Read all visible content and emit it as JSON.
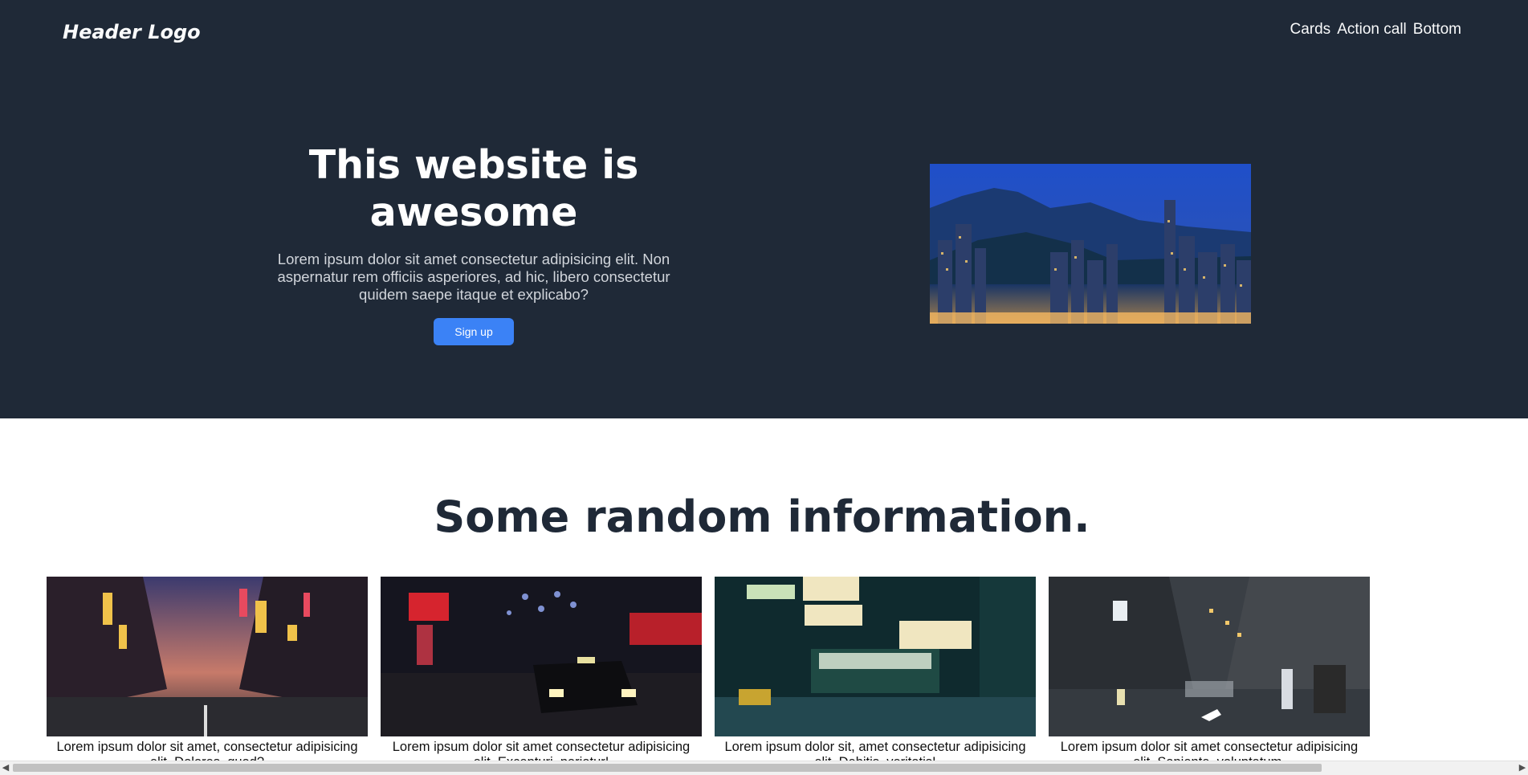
{
  "header": {
    "logo": "Header Logo",
    "nav": [
      "Cards",
      "Action call",
      "Bottom"
    ]
  },
  "hero": {
    "title": "This website is awesome",
    "subtitle": "Lorem ipsum dolor sit amet consectetur adipisicing elit. Non aspernatur rem officiis asperiores, ad hic, libero consectetur quidem saepe itaque et explicabo?",
    "button": "Sign up",
    "image_name": "city-skyline-night-photo"
  },
  "section": {
    "title": "Some random information."
  },
  "cards": [
    {
      "text": "Lorem ipsum dolor sit amet, consectetur adipisicing elit. Dolores, quod?",
      "image_name": "neon-street-sunset-photo"
    },
    {
      "text": "Lorem ipsum dolor sit amet consectetur adipisicing elit. Excepturi, pariatur!",
      "image_name": "taxi-night-street-photo"
    },
    {
      "text": "Lorem ipsum dolor sit, amet consectetur adipisicing elit. Debitis, veritatis!",
      "image_name": "night-market-stall-photo"
    },
    {
      "text": "Lorem ipsum dolor sit amet consectetur adipisicing elit. Sapiente, voluptatum.",
      "image_name": "narrow-alley-street-photo"
    }
  ],
  "colors": {
    "hero_bg": "#1f2937",
    "button": "#3b82f6",
    "heading_dark": "#1f2937"
  }
}
